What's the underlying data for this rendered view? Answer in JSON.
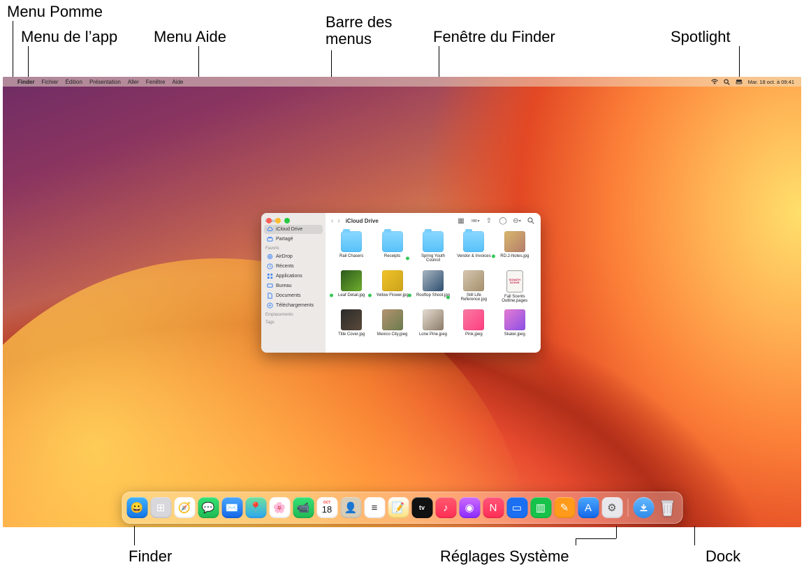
{
  "callouts": {
    "apple_menu": "Menu Pomme",
    "app_menu": "Menu de l’app",
    "help_menu": "Menu Aide",
    "menu_bar": "Barre des\nmenus",
    "finder_window": "Fenêtre du Finder",
    "spotlight": "Spotlight",
    "finder": "Finder",
    "system_settings": "Réglages Système",
    "dock": "Dock"
  },
  "menubar": {
    "apple": "",
    "items": [
      "Finder",
      "Fichier",
      "Édition",
      "Présentation",
      "Aller",
      "Fenêtre",
      "Aide"
    ],
    "clock": "Mar. 18 oct. à  09:41"
  },
  "finder": {
    "title": "iCloud Drive",
    "sidebar": {
      "sections": [
        {
          "label": "iCloud",
          "items": [
            {
              "name": "iCloud Drive",
              "icon": "cloud",
              "active": true
            },
            {
              "name": "Partagé",
              "icon": "shared",
              "active": false
            }
          ]
        },
        {
          "label": "Favoris",
          "items": [
            {
              "name": "AirDrop",
              "icon": "airdrop"
            },
            {
              "name": "Récents",
              "icon": "clock"
            },
            {
              "name": "Applications",
              "icon": "apps"
            },
            {
              "name": "Bureau",
              "icon": "desktop"
            },
            {
              "name": "Documents",
              "icon": "doc"
            },
            {
              "name": "Téléchargements",
              "icon": "download"
            }
          ]
        },
        {
          "label": "Emplacements",
          "items": []
        },
        {
          "label": "Tags",
          "items": []
        }
      ]
    },
    "files": [
      {
        "name": "Rail Chasers",
        "kind": "folder",
        "synced": false
      },
      {
        "name": "Receipts",
        "kind": "folder",
        "synced": false
      },
      {
        "name": "Spring Youth Council",
        "kind": "folder",
        "synced": true
      },
      {
        "name": "Vendor & Invoices",
        "kind": "folder",
        "synced": false
      },
      {
        "name": "RD.2-Notes.jpg",
        "kind": "image",
        "synced": true,
        "bg": "linear-gradient(135deg,#d9b86b,#b47c6d)"
      },
      {
        "name": "Leaf Detail.jpg",
        "kind": "image",
        "synced": true,
        "bg": "linear-gradient(135deg,#2c5a1d,#6fae2c)"
      },
      {
        "name": "Yellow Flower.jpg",
        "kind": "image",
        "synced": true,
        "bg": "linear-gradient(135deg,#f1c32b,#caa31a)"
      },
      {
        "name": "Rooftop Shoot.jpg",
        "kind": "image",
        "synced": true,
        "bg": "linear-gradient(135deg,#a9b6c0,#2e4e71)"
      },
      {
        "name": "Still Life Reference.jpg",
        "kind": "image",
        "synced": true,
        "bg": "linear-gradient(135deg,#d6c7b0,#a58f6c)"
      },
      {
        "name": "Fall Scents Outline.pages",
        "kind": "page",
        "synced": false,
        "bg": "linear-gradient(#f8f6f2,#f8f6f2)"
      },
      {
        "name": "Title Cover.jpg",
        "kind": "image",
        "bg": "linear-gradient(135deg,#2b2b2b,#5a4a3a)"
      },
      {
        "name": "Mexico City.jpeg",
        "kind": "image",
        "bg": "linear-gradient(135deg,#b4946e,#6b7a4f)"
      },
      {
        "name": "Lone Pine.jpeg",
        "kind": "image",
        "bg": "linear-gradient(135deg,#e5ddd2,#8c7a68)"
      },
      {
        "name": "Pink.jpeg",
        "kind": "image",
        "bg": "linear-gradient(135deg,#f87aa3,#ff3e7f)"
      },
      {
        "name": "Skater.jpeg",
        "kind": "image",
        "bg": "linear-gradient(135deg,#e67bd4,#8a4fe4)"
      }
    ]
  },
  "dock_apps": [
    {
      "name": "Finder",
      "bg": "linear-gradient(#3fb3ff,#1173e6)",
      "glyph": "😀"
    },
    {
      "name": "Launchpad",
      "bg": "#d7d7dc",
      "glyph": "⊞"
    },
    {
      "name": "Safari",
      "bg": "#fff",
      "glyph": "🧭"
    },
    {
      "name": "Messages",
      "bg": "linear-gradient(#34e273,#1fb954)",
      "glyph": "💬"
    },
    {
      "name": "Mail",
      "bg": "linear-gradient(#4aa8ff,#1366e8)",
      "glyph": "✉️"
    },
    {
      "name": "Plans",
      "bg": "linear-gradient(#6fe29a,#2ca6f2)",
      "glyph": "📍"
    },
    {
      "name": "Photos",
      "bg": "#fff",
      "glyph": "🌸"
    },
    {
      "name": "FaceTime",
      "bg": "linear-gradient(#36e276,#1fb954)",
      "glyph": "📹"
    },
    {
      "name": "Calendrier",
      "bg": "#fff",
      "glyph": "18",
      "text": "#ff3b30"
    },
    {
      "name": "Contacts",
      "bg": "#d7cdb8",
      "glyph": "👤"
    },
    {
      "name": "Rappels",
      "bg": "#fff",
      "glyph": "≡",
      "text": "#333"
    },
    {
      "name": "Notes",
      "bg": "linear-gradient(#fff,#ffe17a)",
      "glyph": "📝"
    },
    {
      "name": "TV",
      "bg": "#111",
      "glyph": "▶︎tv",
      "text": "#fff"
    },
    {
      "name": "Musique",
      "bg": "linear-gradient(#ff5a6e,#ff2d55)",
      "glyph": "♪"
    },
    {
      "name": "Podcasts",
      "bg": "linear-gradient(#cc6bff,#8b2bff)",
      "glyph": "◉"
    },
    {
      "name": "News",
      "bg": "linear-gradient(#ff5678,#ff2d55)",
      "glyph": "N"
    },
    {
      "name": "Keynote",
      "bg": "#1b6ff2",
      "glyph": "▭",
      "text": "#fff"
    },
    {
      "name": "Numbers",
      "bg": "#16c24a",
      "glyph": "▥",
      "text": "#fff"
    },
    {
      "name": "Pages",
      "bg": "#ff9a1a",
      "glyph": "✎",
      "text": "#fff"
    },
    {
      "name": "App Store",
      "bg": "linear-gradient(#4aa8ff,#1366e8)",
      "glyph": "A"
    },
    {
      "name": "Réglages Système",
      "bg": "#e8e8ec",
      "glyph": "⚙︎",
      "text": "#555"
    }
  ]
}
